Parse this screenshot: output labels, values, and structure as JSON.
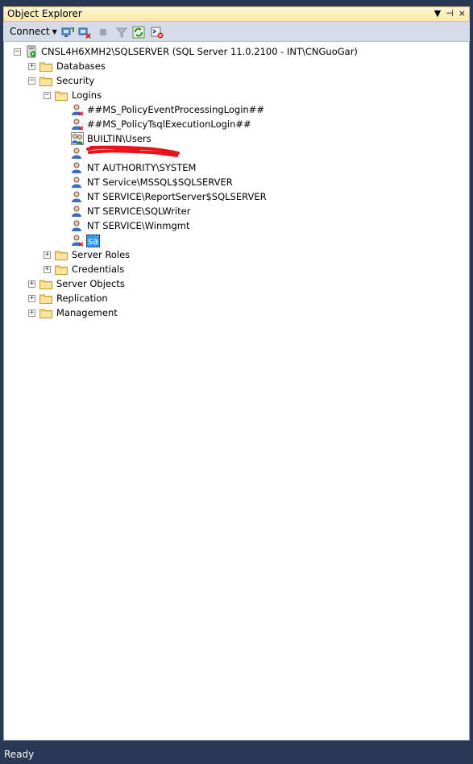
{
  "panel": {
    "title": "Object Explorer",
    "controls": [
      "▼",
      "⊣",
      "×"
    ]
  },
  "toolbar": {
    "connect_label": "Connect",
    "icons": [
      "connect-object-explorer-icon",
      "disconnect-icon",
      "stop-icon",
      "filter-icon",
      "refresh-icon",
      "start-powershell-icon"
    ]
  },
  "tree": {
    "server": "CNSL4H6XMH2\\SQLSERVER (SQL Server 11.0.2100 - INT\\CNGuoGar)",
    "databases": "Databases",
    "security": "Security",
    "logins": "Logins",
    "login_items": [
      "##MS_PolicyEventProcessingLogin##",
      "##MS_PolicyTsqlExecutionLogin##",
      "BUILTIN\\Users",
      "",
      "NT AUTHORITY\\SYSTEM",
      "NT Service\\MSSQL$SQLSERVER",
      "NT SERVICE\\ReportServer$SQLSERVER",
      "NT SERVICE\\SQLWriter",
      "NT SERVICE\\Winmgmt",
      "sa"
    ],
    "server_roles": "Server Roles",
    "credentials": "Credentials",
    "server_objects": "Server Objects",
    "replication": "Replication",
    "management": "Management"
  },
  "status": {
    "text": "Ready"
  },
  "colors": {
    "frame": "#293955",
    "title_bg": "#ffe8a6",
    "selection": "#3399ff",
    "redaction": "#e8141b"
  }
}
